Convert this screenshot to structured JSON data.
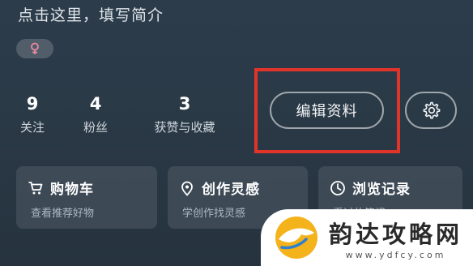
{
  "profile": {
    "bio_placeholder": "点击这里，填写简介",
    "gender_icon": "female-symbol-icon"
  },
  "stats": [
    {
      "value": "9",
      "label": "关注"
    },
    {
      "value": "4",
      "label": "粉丝"
    },
    {
      "value": "3",
      "label": "获赞与收藏"
    }
  ],
  "actions": {
    "edit_label": "编辑资料",
    "settings_icon": "gear-icon"
  },
  "cards": [
    {
      "icon": "cart-icon",
      "title": "购物车",
      "subtitle": "查看推荐好物"
    },
    {
      "icon": "lightbulb-pin-icon",
      "title": "创作灵感",
      "subtitle": "学创作找灵感"
    },
    {
      "icon": "clock-icon",
      "title": "浏览记录",
      "subtitle": "看过的笔记"
    }
  ],
  "annotation": {
    "highlight_color": "#e0342a"
  },
  "watermark": {
    "name": "韵达攻略网",
    "url": "www.ydfcy.com"
  },
  "colors": {
    "background": "#2c3c4b",
    "card": "rgba(255,255,255,0.10)"
  }
}
